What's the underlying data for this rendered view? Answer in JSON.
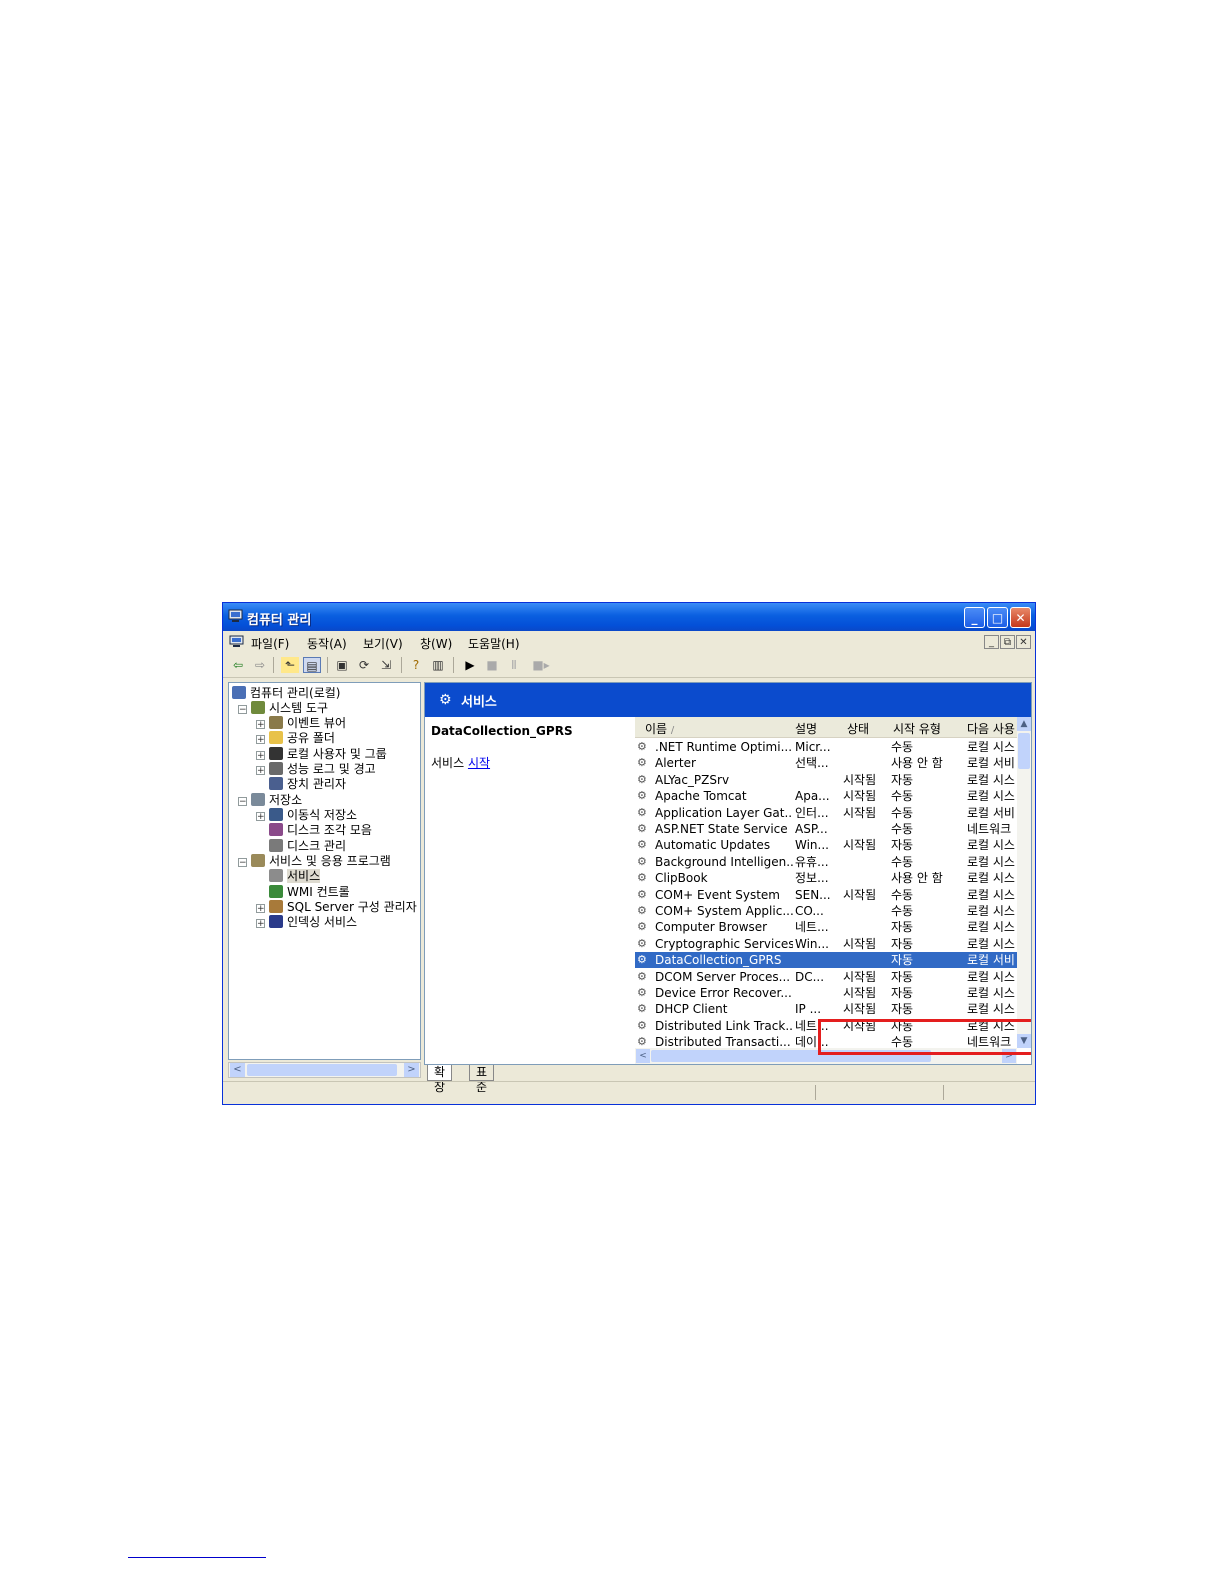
{
  "window": {
    "title": "컴퓨터 관리",
    "controls": {
      "minimize": "_",
      "maximize": "□",
      "close": "✕"
    }
  },
  "menu": {
    "items": [
      "파일(F)",
      "동작(A)",
      "보기(V)",
      "창(W)",
      "도움말(H)"
    ],
    "mdi": [
      "_",
      "⧉",
      "✕"
    ]
  },
  "toolbar": {
    "back": "⇦",
    "forward": "⇨",
    "up": "⬑",
    "show_tree": "▤",
    "properties": "▣",
    "refresh": "⟳",
    "export": "⇲",
    "help": "?",
    "view": "▥",
    "play": "▶",
    "stop": "■",
    "pause": "Ⅱ",
    "restart": "■▸"
  },
  "tree": {
    "root": "컴퓨터 관리(로컬)",
    "system_tools": "시스템 도구",
    "event_viewer": "이벤트 뷰어",
    "shared_folders": "공유 폴더",
    "local_users": "로컬 사용자 및 그룹",
    "perf_logs": "성능 로그 및 경고",
    "device_manager": "장치 관리자",
    "storage": "저장소",
    "removable": "이동식 저장소",
    "defrag": "디스크 조각 모음",
    "disk_mgmt": "디스크 관리",
    "services_apps": "서비스 및 응용 프로그램",
    "services": "서비스",
    "wmi": "WMI 컨트롤",
    "sql": "SQL Server 구성 관리자",
    "indexing": "인덱싱 서비스",
    "scroll_left": "<",
    "scroll_right": ">"
  },
  "panel": {
    "header": "서비스",
    "selected_name": "DataCollection_GPRS",
    "action_prefix": "서비스 ",
    "action_link": "시작"
  },
  "columns": {
    "name": "이름",
    "sort": "/",
    "desc": "설명",
    "status": "상태",
    "startup": "시작 유형",
    "logon": "다음 사용"
  },
  "services": [
    {
      "name": ".NET Runtime Optimi...",
      "desc": "Micr...",
      "status": "",
      "startup": "수동",
      "logon": "로컬 시스"
    },
    {
      "name": "Alerter",
      "desc": "선택...",
      "status": "",
      "startup": "사용 안 함",
      "logon": "로컬 서비"
    },
    {
      "name": "ALYac_PZSrv",
      "desc": "",
      "status": "시작됨",
      "startup": "자동",
      "logon": "로컬 시스"
    },
    {
      "name": "Apache Tomcat",
      "desc": "Apa...",
      "status": "시작됨",
      "startup": "수동",
      "logon": "로컬 시스"
    },
    {
      "name": "Application Layer Gat...",
      "desc": "인터...",
      "status": "시작됨",
      "startup": "수동",
      "logon": "로컬 서비"
    },
    {
      "name": "ASP.NET State Service",
      "desc": "ASP...",
      "status": "",
      "startup": "수동",
      "logon": "네트워크"
    },
    {
      "name": "Automatic Updates",
      "desc": "Win...",
      "status": "시작됨",
      "startup": "자동",
      "logon": "로컬 시스"
    },
    {
      "name": "Background Intelligen...",
      "desc": "유휴...",
      "status": "",
      "startup": "수동",
      "logon": "로컬 시스"
    },
    {
      "name": "ClipBook",
      "desc": "정보...",
      "status": "",
      "startup": "사용 안 함",
      "logon": "로컬 시스"
    },
    {
      "name": "COM+ Event System",
      "desc": "SEN...",
      "status": "시작됨",
      "startup": "수동",
      "logon": "로컬 시스"
    },
    {
      "name": "COM+ System Applic...",
      "desc": "CO...",
      "status": "",
      "startup": "수동",
      "logon": "로컬 시스"
    },
    {
      "name": "Computer Browser",
      "desc": "네트...",
      "status": "",
      "startup": "자동",
      "logon": "로컬 시스"
    },
    {
      "name": "Cryptographic Services",
      "desc": "Win...",
      "status": "시작됨",
      "startup": "자동",
      "logon": "로컬 시스"
    },
    {
      "name": "DataCollection_GPRS",
      "desc": "",
      "status": "",
      "startup": "자동",
      "logon": "로컬 서비"
    },
    {
      "name": "DCOM Server Proces...",
      "desc": "DC...",
      "status": "시작됨",
      "startup": "자동",
      "logon": "로컬 시스"
    },
    {
      "name": "Device Error Recover...",
      "desc": "",
      "status": "시작됨",
      "startup": "자동",
      "logon": "로컬 시스"
    },
    {
      "name": "DHCP Client",
      "desc": "IP ...",
      "status": "시작됨",
      "startup": "자동",
      "logon": "로컬 시스"
    },
    {
      "name": "Distributed Link Track...",
      "desc": "네트...",
      "status": "시작됨",
      "startup": "자동",
      "logon": "로컬 시스"
    },
    {
      "name": "Distributed Transacti...",
      "desc": "데이...",
      "status": "",
      "startup": "수동",
      "logon": "네트워크"
    }
  ],
  "selected_index": 13,
  "gear_icon_glyph": "⚙",
  "tabs": {
    "extended": "확장",
    "standard": "표준"
  },
  "scroll": {
    "up": "▲",
    "down": "▼",
    "left": "<",
    "right": ">"
  },
  "colors": {
    "titlebar": "#0a5fe0",
    "selection": "#316ac5",
    "highlight_box": "#e41e1e"
  }
}
